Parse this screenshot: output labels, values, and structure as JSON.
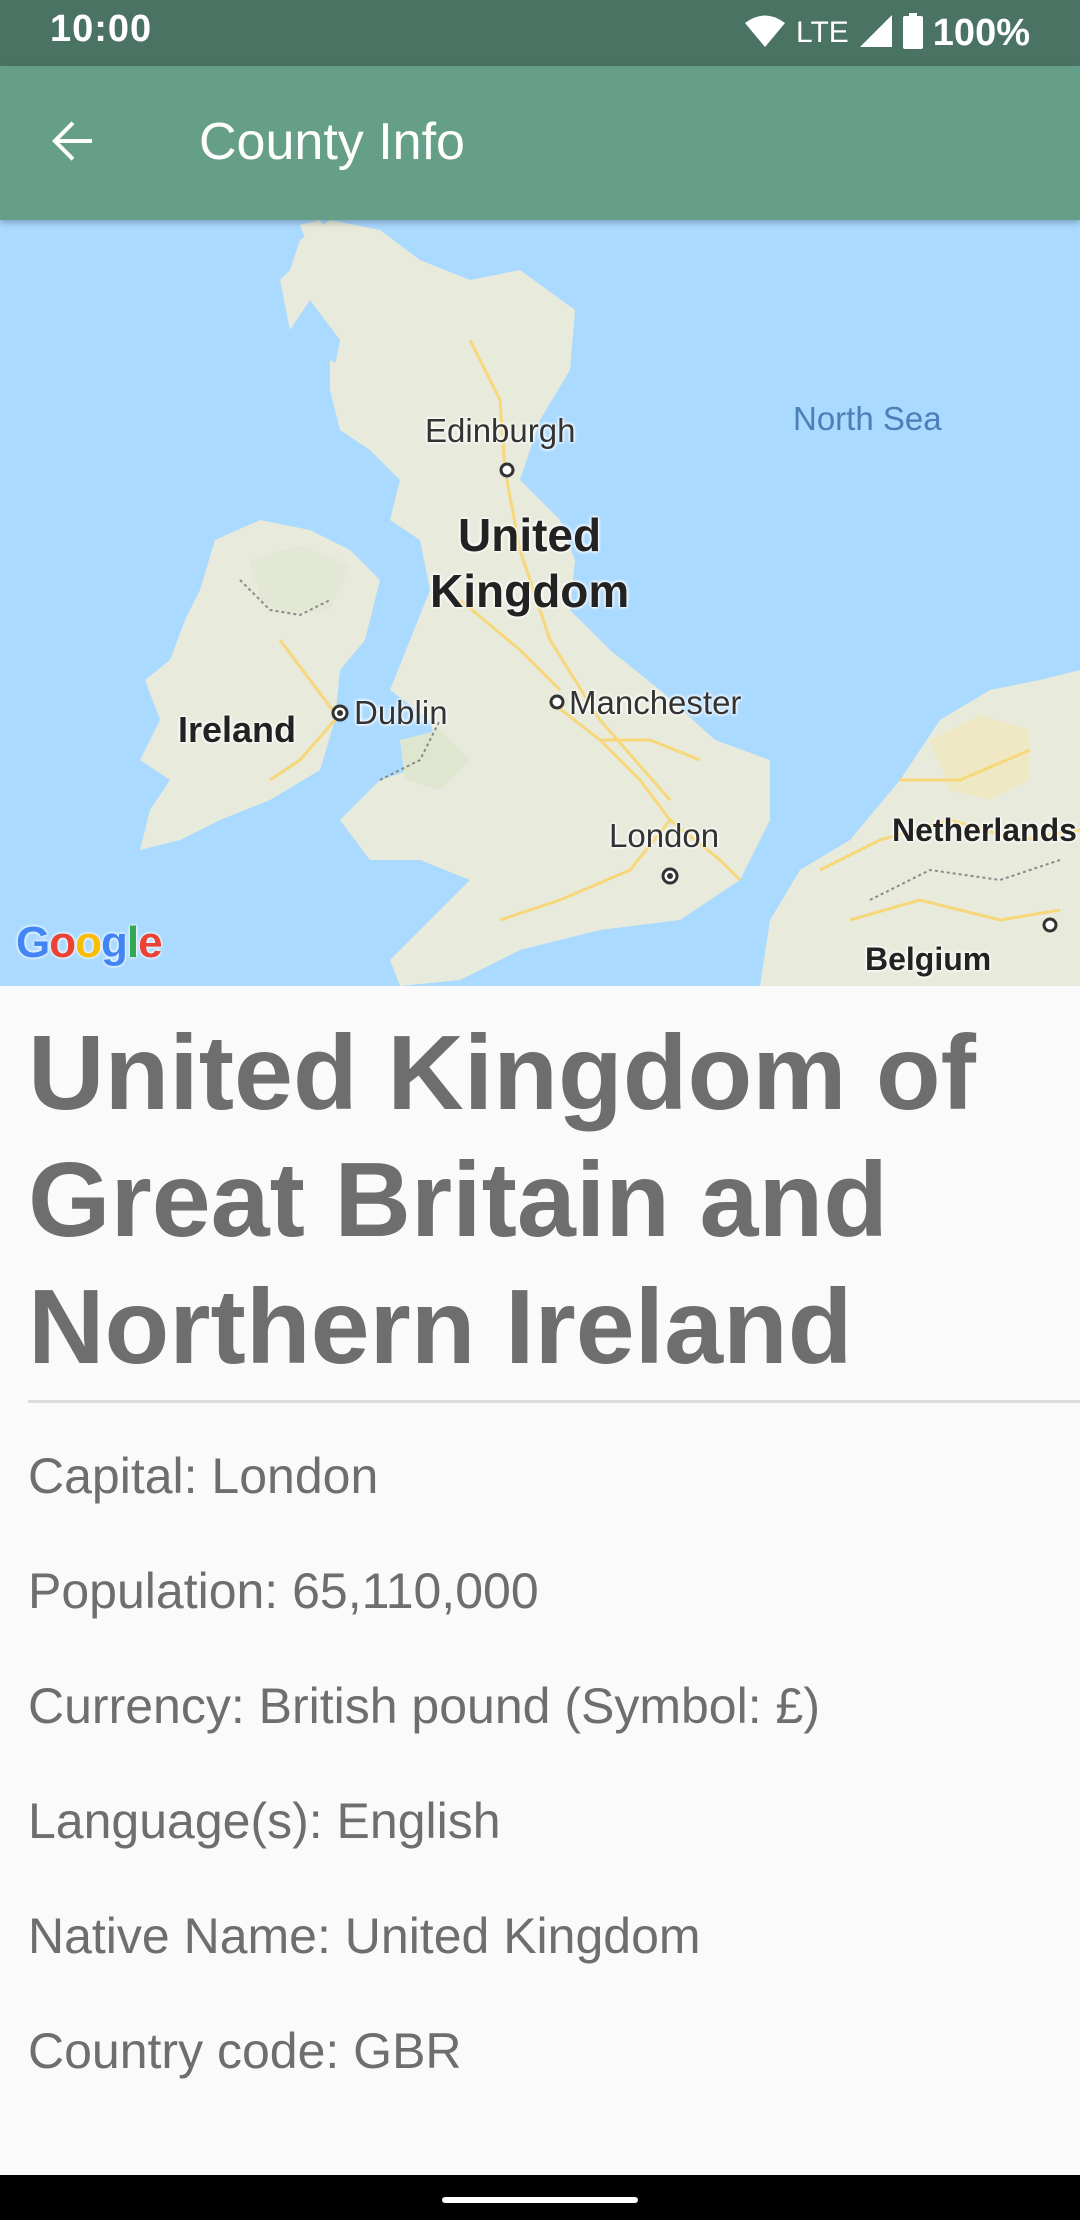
{
  "status_bar": {
    "time": "10:00",
    "network": "LTE",
    "battery": "100%",
    "icons": [
      "wifi-icon",
      "cell-signal-icon",
      "battery-icon"
    ]
  },
  "app_bar": {
    "title": "County Info",
    "back_icon": "arrow-back-icon"
  },
  "map": {
    "labels": {
      "edinburgh": "Edinburgh",
      "north_sea": "North Sea",
      "united": "United",
      "kingdom": "Kingdom",
      "ireland": "Ireland",
      "dublin": "Dublin",
      "manchester": "Manchester",
      "london": "London",
      "netherlands": "Netherlands",
      "belgium": "Belgium"
    },
    "attribution": "Google",
    "colors": {
      "water": "#aadaff",
      "land": "#e8eadb",
      "roads": "#f6d77a"
    }
  },
  "country": {
    "name": "United Kingdom of Great Britain and Northern Ireland",
    "details": [
      "Capital: London",
      "Population: 65,110,000",
      "Currency: British pound (Symbol: £)",
      "Language(s): English",
      "Native Name: United Kingdom",
      "Country code: GBR"
    ]
  },
  "theme": {
    "status_bar": "#4b7364",
    "app_bar": "#659f87",
    "text": "#6e6e6e"
  }
}
